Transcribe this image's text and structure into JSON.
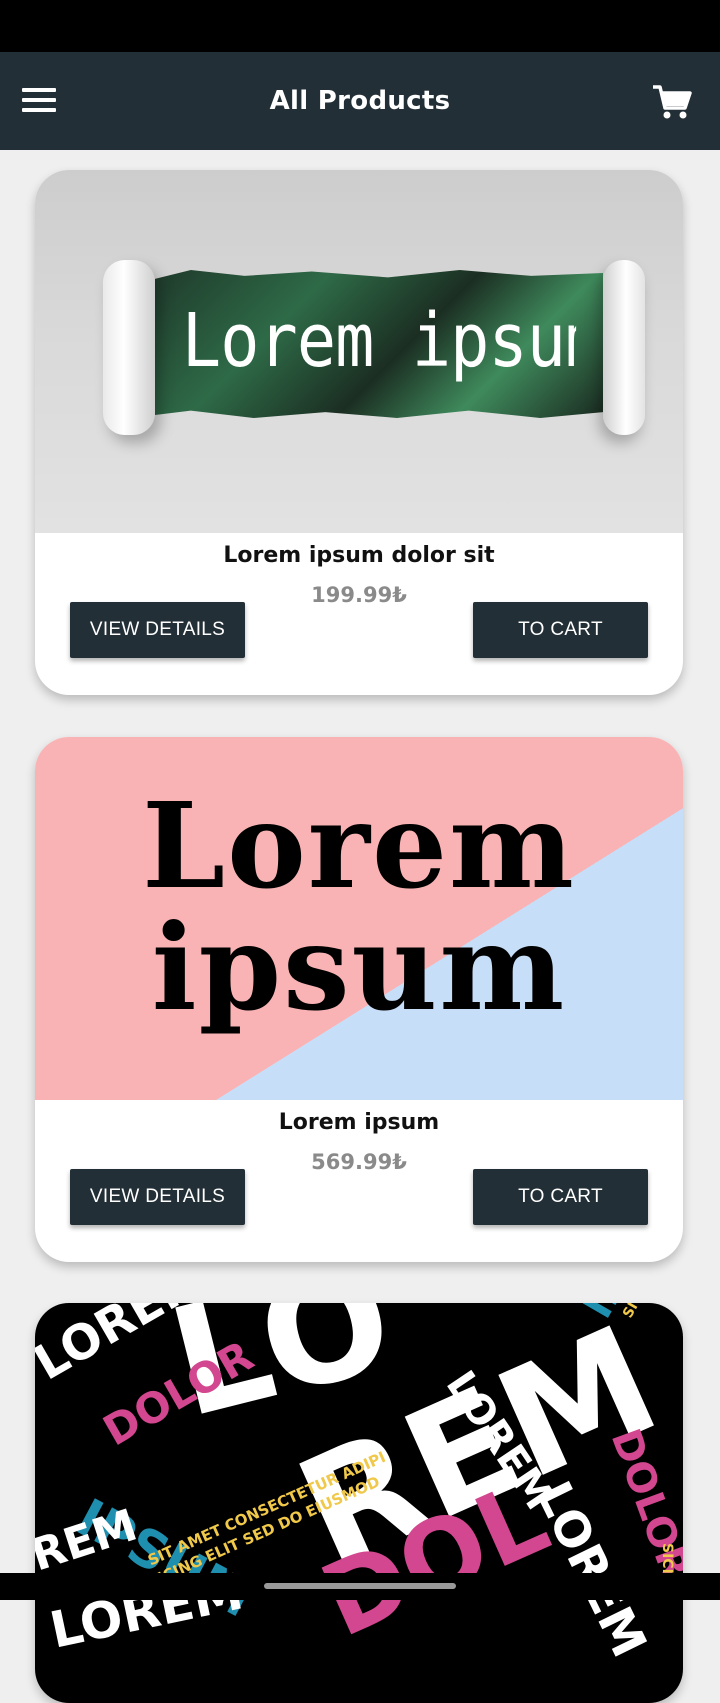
{
  "header": {
    "title": "All Products",
    "menu_icon": "hamburger-menu-icon",
    "cart_icon": "shopping-cart-icon"
  },
  "products": [
    {
      "image_text": "Lorem ipsum",
      "name": "Lorem ipsum dolor sit",
      "price": "199.99₺",
      "details_label": "VIEW DETAILS",
      "cart_label": "TO CART"
    },
    {
      "image_text_line1": "Lorem",
      "image_text_line2": "ipsum",
      "name": "Lorem ipsum",
      "price": "569.99₺",
      "details_label": "VIEW DETAILS",
      "cart_label": "TO CART"
    },
    {
      "image_words": {
        "lorem": "LOREM",
        "lo": "LO",
        "rem": "REM",
        "ipsum": "IPSUM",
        "dolor": "DOLOR",
        "dol": "DOL",
        "sit_amet": "SIT AMET CONSECTETUR ADIPI",
        "sicing": "SICING ELIT SED DO EIUSMOD",
        "sicing_short": "SICING"
      }
    }
  ],
  "colors": {
    "app_bar": "#232f36",
    "button": "#232f36",
    "background": "#efefef",
    "price": "#8a8a8a",
    "collage_pink": "#d2478f",
    "collage_teal": "#1f8fb0",
    "collage_yellow": "#f0c84a"
  }
}
